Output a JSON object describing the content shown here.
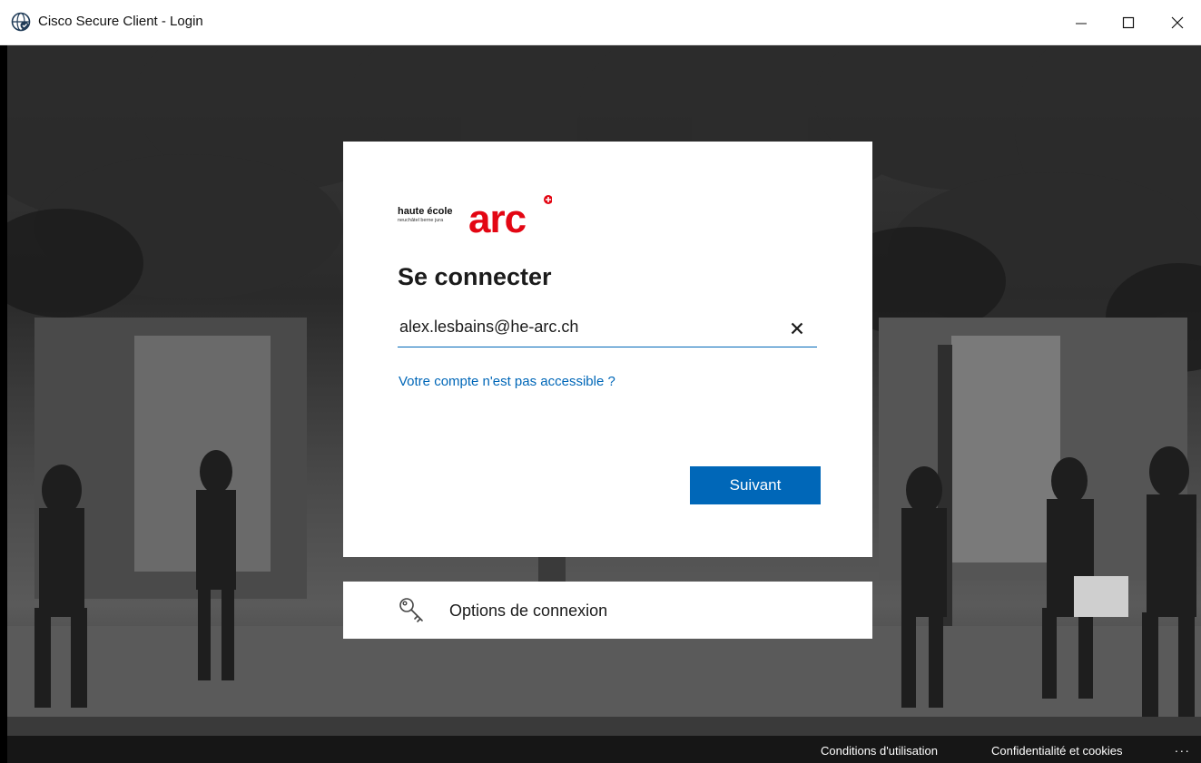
{
  "window": {
    "title": "Cisco Secure Client - Login",
    "app_icon": "cisco-globe-icon",
    "controls": [
      "minimize-icon",
      "maximize-icon",
      "close-icon"
    ]
  },
  "card": {
    "logo": {
      "line1": "haute école",
      "line2": "neuchâtel berne jura",
      "mark": "arc"
    },
    "heading": "Se connecter",
    "email_value": "alex.lesbains@he-arc.ch",
    "clear_icon": "close-icon",
    "access_link": "Votre compte n'est pas accessible ?",
    "next_button": "Suivant"
  },
  "options": {
    "icon": "key-icon",
    "label": "Options de connexion"
  },
  "footer": {
    "terms": "Conditions d'utilisation",
    "privacy": "Confidentialité et cookies",
    "more": "..."
  },
  "colors": {
    "accent": "#0067b8",
    "brand_red": "#e30613",
    "text": "#1b1b1b",
    "card_bg": "#ffffff"
  }
}
